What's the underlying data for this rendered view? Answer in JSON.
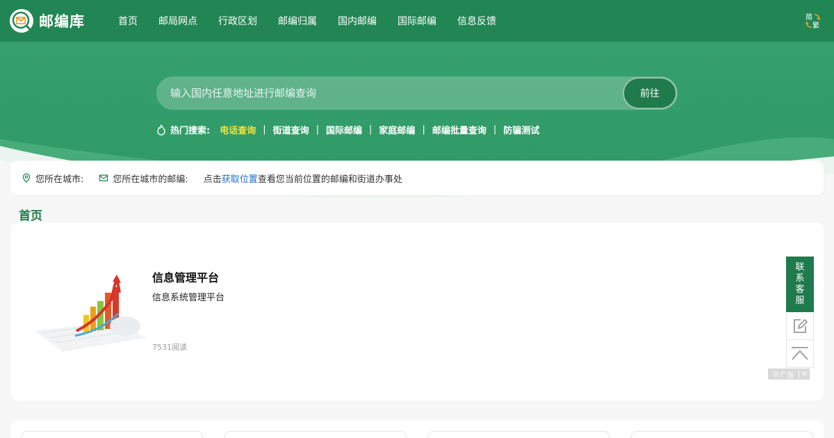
{
  "brand": {
    "name": "邮编库"
  },
  "nav": {
    "items": [
      "首页",
      "邮局网点",
      "行政区划",
      "邮编归属",
      "国内邮编",
      "国际邮编",
      "信息反馈"
    ]
  },
  "lang_toggle": {
    "top": "简",
    "bottom": "繁"
  },
  "search": {
    "placeholder": "输入国内任意地址进行邮编查询",
    "button": "前往"
  },
  "hot": {
    "label": "热门搜索:",
    "links": [
      "电话查询",
      "街道查询",
      "国际邮编",
      "家庭邮编",
      "邮编批量查询",
      "防骗测试"
    ],
    "separator": "|"
  },
  "location": {
    "city_label": "您所在城市:",
    "zip_label": "您所在城市的邮编:",
    "prompt_prefix": "点击",
    "prompt_link": "获取位置",
    "prompt_suffix": "查看您当前位置的邮编和街道办事处"
  },
  "section": {
    "title": "首页"
  },
  "card": {
    "title": "信息管理平台",
    "desc": "信息系统管理平台",
    "reads": "7531阅读",
    "ad_label": "广告",
    "ad_close": "✕"
  },
  "side": {
    "service": [
      "联",
      "系",
      "客",
      "服"
    ]
  },
  "colors": {
    "nav_bg": "#228654",
    "hero_bg": "#35a06d",
    "accent": "#1f7a4c",
    "highlight": "#f3e43b",
    "link": "#1f6fd1"
  }
}
